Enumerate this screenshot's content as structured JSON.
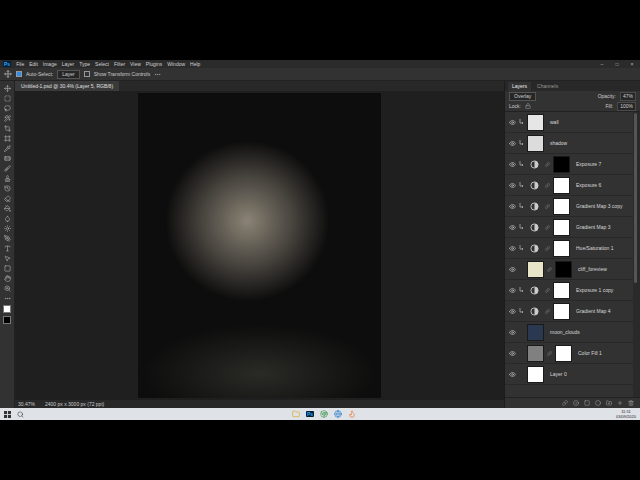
{
  "app": {
    "logo": "Ps",
    "menu": [
      "File",
      "Edit",
      "Image",
      "Layer",
      "Type",
      "Select",
      "Filter",
      "View",
      "Plugins",
      "Window",
      "Help"
    ],
    "window_controls": [
      "–",
      "□",
      "×"
    ]
  },
  "options_bar": {
    "auto_select_label": "Auto-Select:",
    "auto_select_checked": true,
    "target": "Layer",
    "show_transform_label": "Show Transform Controls",
    "show_transform_checked": false
  },
  "document_tab": {
    "title": "Untitled-1.psd @ 30.4% (Layer 5, RGB/8)"
  },
  "status_bar": {
    "zoom": "30.47%",
    "info": "2400 px x 3000 px (72 ppi)"
  },
  "layers_panel": {
    "tabs": [
      {
        "label": "Layers",
        "selected": true
      },
      {
        "label": "Channels",
        "selected": false
      }
    ],
    "blend_mode": "Overlay",
    "opacity_label": "Opacity:",
    "opacity": "47%",
    "lock_label": "Lock:",
    "fill_label": "Fill:",
    "fill": "100%",
    "layers": [
      {
        "name": "wall",
        "kind": "pixel",
        "visible": true,
        "clipped": true,
        "thumb": "#e6e6e6",
        "mask": ""
      },
      {
        "name": "shadow",
        "kind": "pixel",
        "visible": true,
        "clipped": true,
        "thumb": "#dcdcdc",
        "mask": ""
      },
      {
        "name": "Exposure 7",
        "kind": "adjustment",
        "visible": true,
        "clipped": true,
        "thumb": "",
        "mask": "#000000"
      },
      {
        "name": "Exposure 6",
        "kind": "adjustment",
        "visible": true,
        "clipped": true,
        "thumb": "",
        "mask": "#ffffff"
      },
      {
        "name": "Gradient Map 3 copy",
        "kind": "adjustment",
        "visible": true,
        "clipped": true,
        "thumb": "",
        "mask": "#ffffff"
      },
      {
        "name": "Gradient Map 3",
        "kind": "adjustment",
        "visible": true,
        "clipped": true,
        "thumb": "",
        "mask": "#ffffff"
      },
      {
        "name": "Hue/Saturation 1",
        "kind": "adjustment",
        "visible": true,
        "clipped": true,
        "thumb": "",
        "mask": "#ffffff"
      },
      {
        "name": "cliff_foreview",
        "kind": "masked",
        "visible": true,
        "clipped": false,
        "thumb": "#e8e4c8",
        "mask": "#000000"
      },
      {
        "name": "Exposure 1 copy",
        "kind": "adjustment",
        "visible": true,
        "clipped": true,
        "thumb": "",
        "mask": "#ffffff"
      },
      {
        "name": "Gradient Map 4",
        "kind": "adjustment",
        "visible": true,
        "clipped": true,
        "thumb": "",
        "mask": "#ffffff"
      },
      {
        "name": "moon_clouds",
        "kind": "pixel",
        "visible": true,
        "clipped": false,
        "thumb": "#2a3850",
        "mask": ""
      },
      {
        "name": "Color Fill 1",
        "kind": "fill",
        "visible": true,
        "clipped": false,
        "thumb": "#808080",
        "mask": "#ffffff"
      },
      {
        "name": "Layer 0",
        "kind": "pixel",
        "visible": true,
        "clipped": false,
        "thumb": "#ffffff",
        "mask": ""
      }
    ]
  },
  "taskbar": {
    "time": "11:51",
    "date": "03/09/2020"
  }
}
